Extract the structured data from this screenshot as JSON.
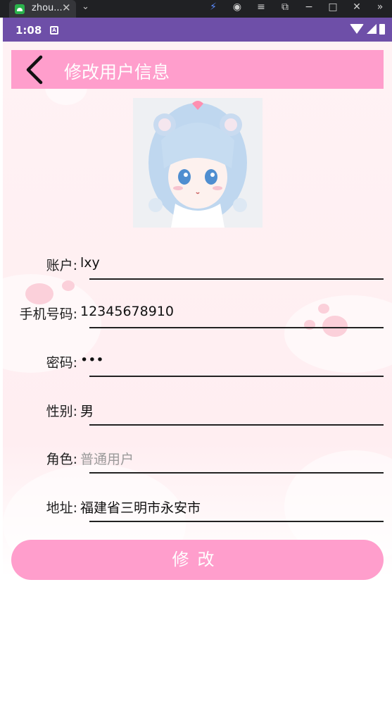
{
  "browser": {
    "tab_title": "zhou...",
    "tab_close": "✕",
    "tab_more": "⌄"
  },
  "status": {
    "time": "1:08",
    "a_icon": "A"
  },
  "header": {
    "title": "修改用户信息",
    "back_icon": "chevron-left-icon"
  },
  "form": {
    "fields": [
      {
        "label": "账户:",
        "value": "lxy",
        "is_placeholder": false
      },
      {
        "label": "手机号码:",
        "value": "12345678910",
        "is_placeholder": false
      },
      {
        "label": "密码:",
        "value": "•••",
        "is_placeholder": false
      },
      {
        "label": "性别:",
        "value": "男",
        "is_placeholder": false
      },
      {
        "label": "角色:",
        "value": "普通用户",
        "is_placeholder": true
      },
      {
        "label": "地址:",
        "value": "福建省三明市永安市",
        "is_placeholder": false
      }
    ],
    "submit_label": "修改"
  },
  "colors": {
    "accent": "#ff9ecc",
    "status_bar": "#6e4fa8",
    "background": "#fff2f4"
  }
}
